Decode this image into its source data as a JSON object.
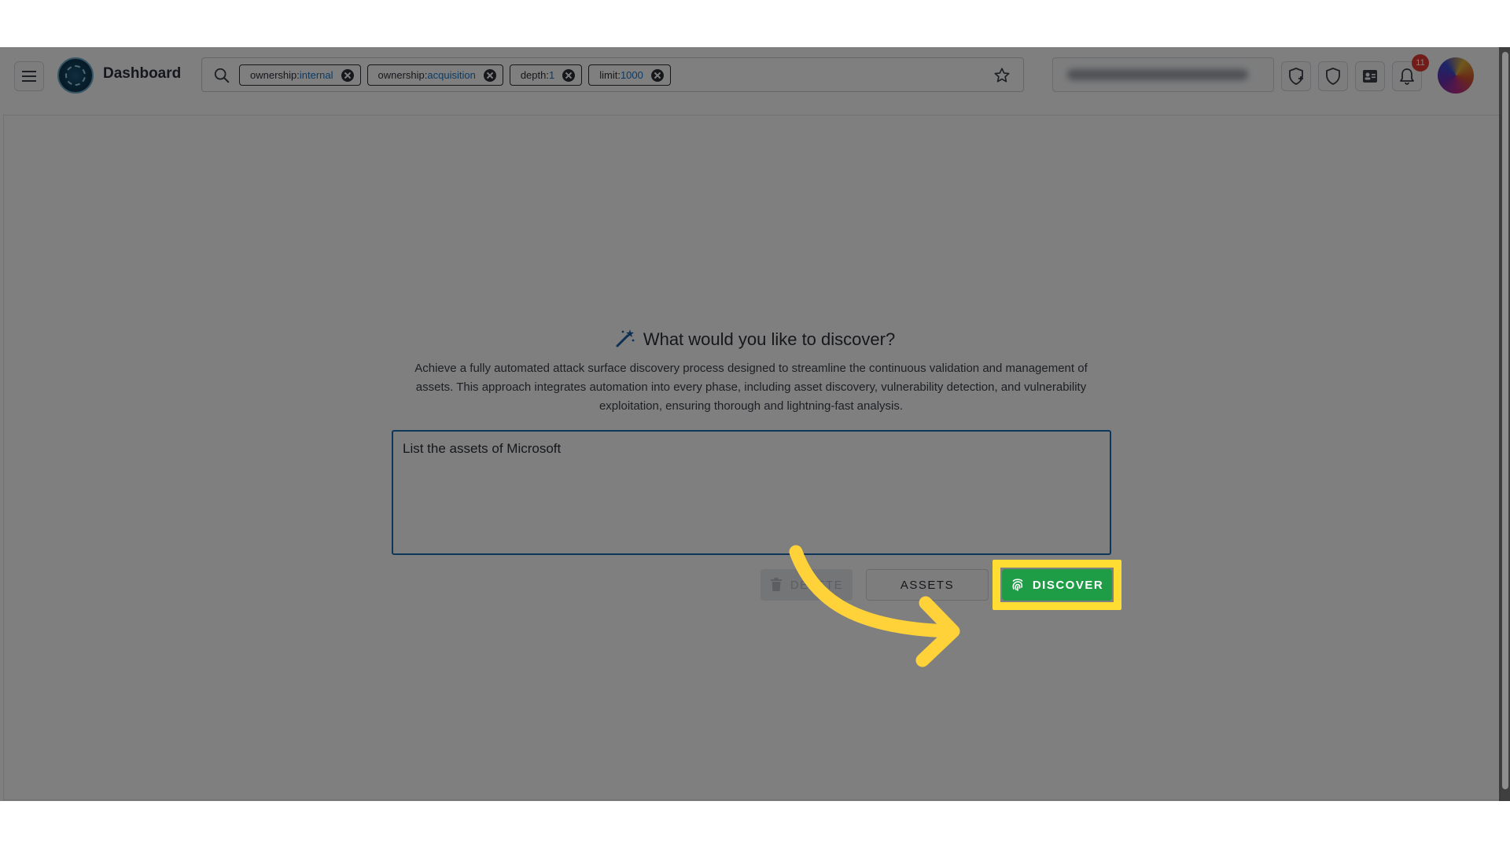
{
  "topbar": {
    "app_title": "Dashboard",
    "chips": [
      {
        "key": "ownership:",
        "value": "internal"
      },
      {
        "key": "ownership:",
        "value": "acquisition"
      },
      {
        "key": "depth:",
        "value": "1"
      },
      {
        "key": "limit:",
        "value": "1000"
      }
    ],
    "notification_count": "11"
  },
  "main": {
    "heading": "What would you like to discover?",
    "description": "Achieve a fully automated attack surface discovery process designed to streamline the continuous validation and management of assets. This approach integrates automation into every phase, including asset discovery, vulnerability detection, and vulnerability exploitation, ensuring thorough and lightning-fast analysis.",
    "prompt_value": "List the assets of Microsoft",
    "buttons": {
      "delete": "DELETE",
      "assets": "ASSETS",
      "discover": "DISCOVER"
    }
  },
  "colors": {
    "accent_blue": "#1675c8",
    "discover_green": "#1f9d46",
    "highlight_yellow": "#ffdd33",
    "badge_red": "#e53935"
  },
  "icons": {
    "menu": "hamburger-icon",
    "search": "search-icon",
    "star": "star-icon",
    "heading": "magic-wand-icon",
    "delete": "trash-icon",
    "discover": "fingerprint-icon"
  }
}
